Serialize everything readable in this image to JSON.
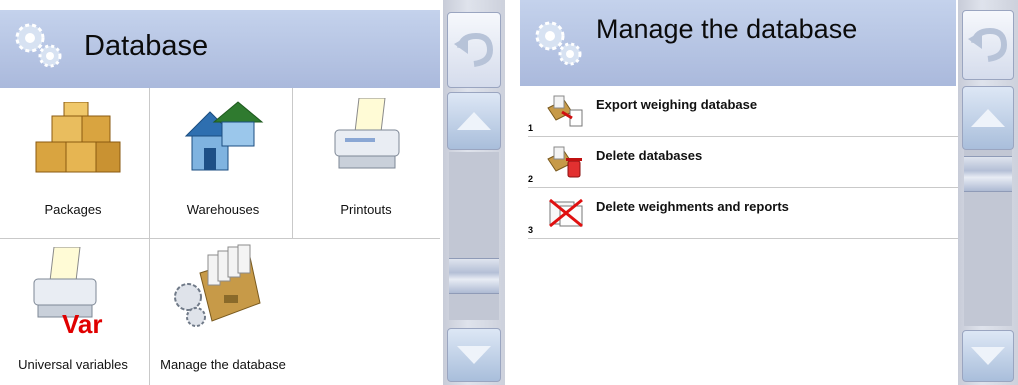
{
  "left": {
    "title": "Database",
    "tiles": [
      {
        "label": "Packages",
        "icon": "packages-icon"
      },
      {
        "label": "Warehouses",
        "icon": "warehouses-icon"
      },
      {
        "label": "Printouts",
        "icon": "printer-icon"
      },
      {
        "label": "Universal variables",
        "icon": "universal-variables-icon",
        "badge": "Var"
      },
      {
        "label": "Manage the database",
        "icon": "manage-database-icon"
      }
    ]
  },
  "right": {
    "title": "Manage the database",
    "items": [
      {
        "number": "1",
        "label": "Export weighing database",
        "icon": "export-database-icon"
      },
      {
        "number": "2",
        "label": "Delete databases",
        "icon": "delete-databases-icon"
      },
      {
        "number": "3",
        "label": "Delete weighments and reports",
        "icon": "delete-weighments-icon"
      }
    ]
  },
  "colors": {
    "header": "#b8c6e6",
    "sidebar": "#d4d8e2",
    "var_badge": "#e00000"
  }
}
